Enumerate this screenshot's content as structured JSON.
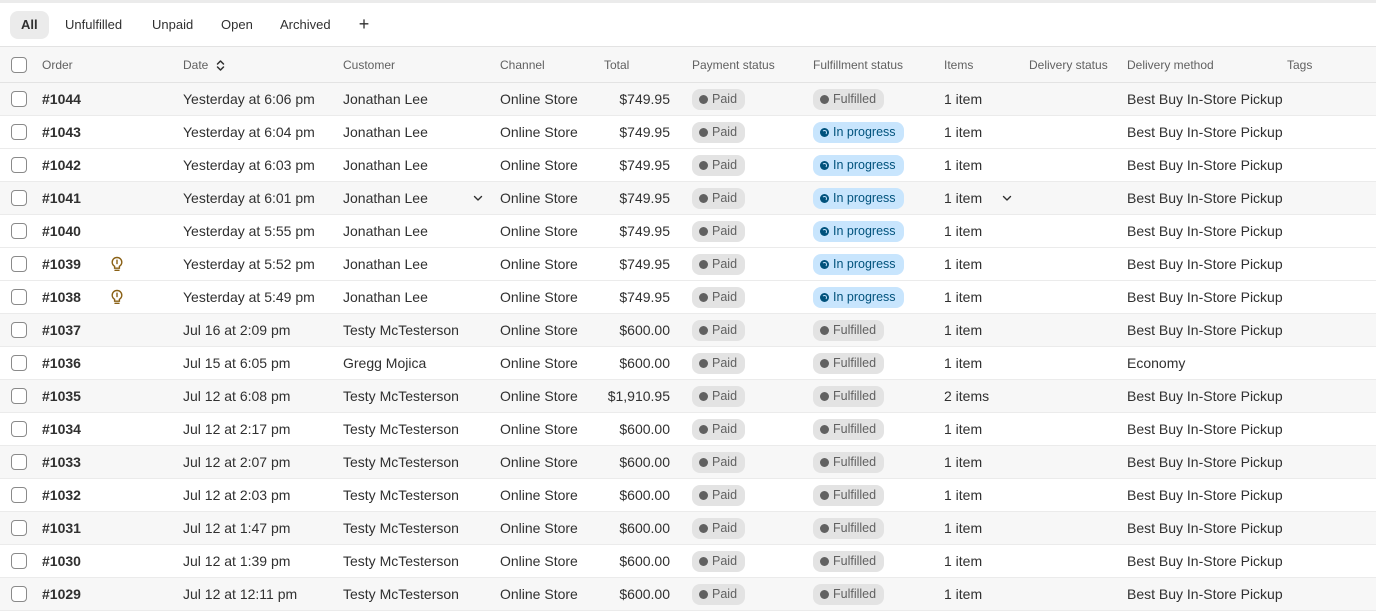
{
  "tabs": [
    {
      "label": "All",
      "active": true
    },
    {
      "label": "Unfulfilled",
      "active": false
    },
    {
      "label": "Unpaid",
      "active": false
    },
    {
      "label": "Open",
      "active": false
    },
    {
      "label": "Archived",
      "active": false
    }
  ],
  "add_tab": "+",
  "columns": {
    "order": "Order",
    "date": "Date",
    "customer": "Customer",
    "channel": "Channel",
    "total": "Total",
    "payment": "Payment status",
    "fulfillment": "Fulfillment status",
    "items": "Items",
    "delivery_status": "Delivery status",
    "delivery_method": "Delivery method",
    "tags": "Tags"
  },
  "sort_icon": "sort-icon",
  "orders": [
    {
      "order": "#1044",
      "note": false,
      "date": "Yesterday at 6:06 pm",
      "customer": "Jonathan Lee",
      "channel": "Online Store",
      "total": "$749.95",
      "payment": "Paid",
      "fulfillment": "Fulfilled",
      "items": "1 item",
      "delivery_method": "Best Buy In-Store Pickup"
    },
    {
      "order": "#1043",
      "note": false,
      "date": "Yesterday at 6:04 pm",
      "customer": "Jonathan Lee",
      "channel": "Online Store",
      "total": "$749.95",
      "payment": "Paid",
      "fulfillment": "In progress",
      "items": "1 item",
      "delivery_method": "Best Buy In-Store Pickup"
    },
    {
      "order": "#1042",
      "note": false,
      "date": "Yesterday at 6:03 pm",
      "customer": "Jonathan Lee",
      "channel": "Online Store",
      "total": "$749.95",
      "payment": "Paid",
      "fulfillment": "In progress",
      "items": "1 item",
      "delivery_method": "Best Buy In-Store Pickup"
    },
    {
      "order": "#1041",
      "note": false,
      "hover": true,
      "date": "Yesterday at 6:01 pm",
      "customer": "Jonathan Lee",
      "channel": "Online Store",
      "total": "$749.95",
      "payment": "Paid",
      "fulfillment": "In progress",
      "items": "1 item",
      "delivery_method": "Best Buy In-Store Pickup"
    },
    {
      "order": "#1040",
      "note": false,
      "date": "Yesterday at 5:55 pm",
      "customer": "Jonathan Lee",
      "channel": "Online Store",
      "total": "$749.95",
      "payment": "Paid",
      "fulfillment": "In progress",
      "items": "1 item",
      "delivery_method": "Best Buy In-Store Pickup"
    },
    {
      "order": "#1039",
      "note": true,
      "date": "Yesterday at 5:52 pm",
      "customer": "Jonathan Lee",
      "channel": "Online Store",
      "total": "$749.95",
      "payment": "Paid",
      "fulfillment": "In progress",
      "items": "1 item",
      "delivery_method": "Best Buy In-Store Pickup"
    },
    {
      "order": "#1038",
      "note": true,
      "date": "Yesterday at 5:49 pm",
      "customer": "Jonathan Lee",
      "channel": "Online Store",
      "total": "$749.95",
      "payment": "Paid",
      "fulfillment": "In progress",
      "items": "1 item",
      "delivery_method": "Best Buy In-Store Pickup"
    },
    {
      "order": "#1037",
      "note": false,
      "date": "Jul 16 at 2:09 pm",
      "customer": "Testy McTesterson",
      "channel": "Online Store",
      "total": "$600.00",
      "payment": "Paid",
      "fulfillment": "Fulfilled",
      "items": "1 item",
      "delivery_method": "Best Buy In-Store Pickup"
    },
    {
      "order": "#1036",
      "note": false,
      "date": "Jul 15 at 6:05 pm",
      "customer": "Gregg Mojica",
      "channel": "Online Store",
      "total": "$600.00",
      "payment": "Paid",
      "fulfillment": "Fulfilled",
      "items": "1 item",
      "delivery_method": "Economy"
    },
    {
      "order": "#1035",
      "note": false,
      "date": "Jul 12 at 6:08 pm",
      "customer": "Testy McTesterson",
      "channel": "Online Store",
      "total": "$1,910.95",
      "payment": "Paid",
      "fulfillment": "Fulfilled",
      "items": "2 items",
      "delivery_method": "Best Buy In-Store Pickup"
    },
    {
      "order": "#1034",
      "note": false,
      "date": "Jul 12 at 2:17 pm",
      "customer": "Testy McTesterson",
      "channel": "Online Store",
      "total": "$600.00",
      "payment": "Paid",
      "fulfillment": "Fulfilled",
      "items": "1 item",
      "delivery_method": "Best Buy In-Store Pickup"
    },
    {
      "order": "#1033",
      "note": false,
      "date": "Jul 12 at 2:07 pm",
      "customer": "Testy McTesterson",
      "channel": "Online Store",
      "total": "$600.00",
      "payment": "Paid",
      "fulfillment": "Fulfilled",
      "items": "1 item",
      "delivery_method": "Best Buy In-Store Pickup"
    },
    {
      "order": "#1032",
      "note": false,
      "date": "Jul 12 at 2:03 pm",
      "customer": "Testy McTesterson",
      "channel": "Online Store",
      "total": "$600.00",
      "payment": "Paid",
      "fulfillment": "Fulfilled",
      "items": "1 item",
      "delivery_method": "Best Buy In-Store Pickup"
    },
    {
      "order": "#1031",
      "note": false,
      "date": "Jul 12 at 1:47 pm",
      "customer": "Testy McTesterson",
      "channel": "Online Store",
      "total": "$600.00",
      "payment": "Paid",
      "fulfillment": "Fulfilled",
      "items": "1 item",
      "delivery_method": "Best Buy In-Store Pickup"
    },
    {
      "order": "#1030",
      "note": false,
      "date": "Jul 12 at 1:39 pm",
      "customer": "Testy McTesterson",
      "channel": "Online Store",
      "total": "$600.00",
      "payment": "Paid",
      "fulfillment": "Fulfilled",
      "items": "1 item",
      "delivery_method": "Best Buy In-Store Pickup"
    },
    {
      "order": "#1029",
      "note": false,
      "date": "Jul 12 at 12:11 pm",
      "customer": "Testy McTesterson",
      "channel": "Online Store",
      "total": "$600.00",
      "payment": "Paid",
      "fulfillment": "Fulfilled",
      "items": "1 item",
      "delivery_method": "Best Buy In-Store Pickup"
    }
  ],
  "colors": {
    "in_progress_bg": "#c8e5fd",
    "in_progress_text": "#00527c",
    "neutral_badge_bg": "#e3e3e3",
    "note_icon": "#8a6116"
  }
}
